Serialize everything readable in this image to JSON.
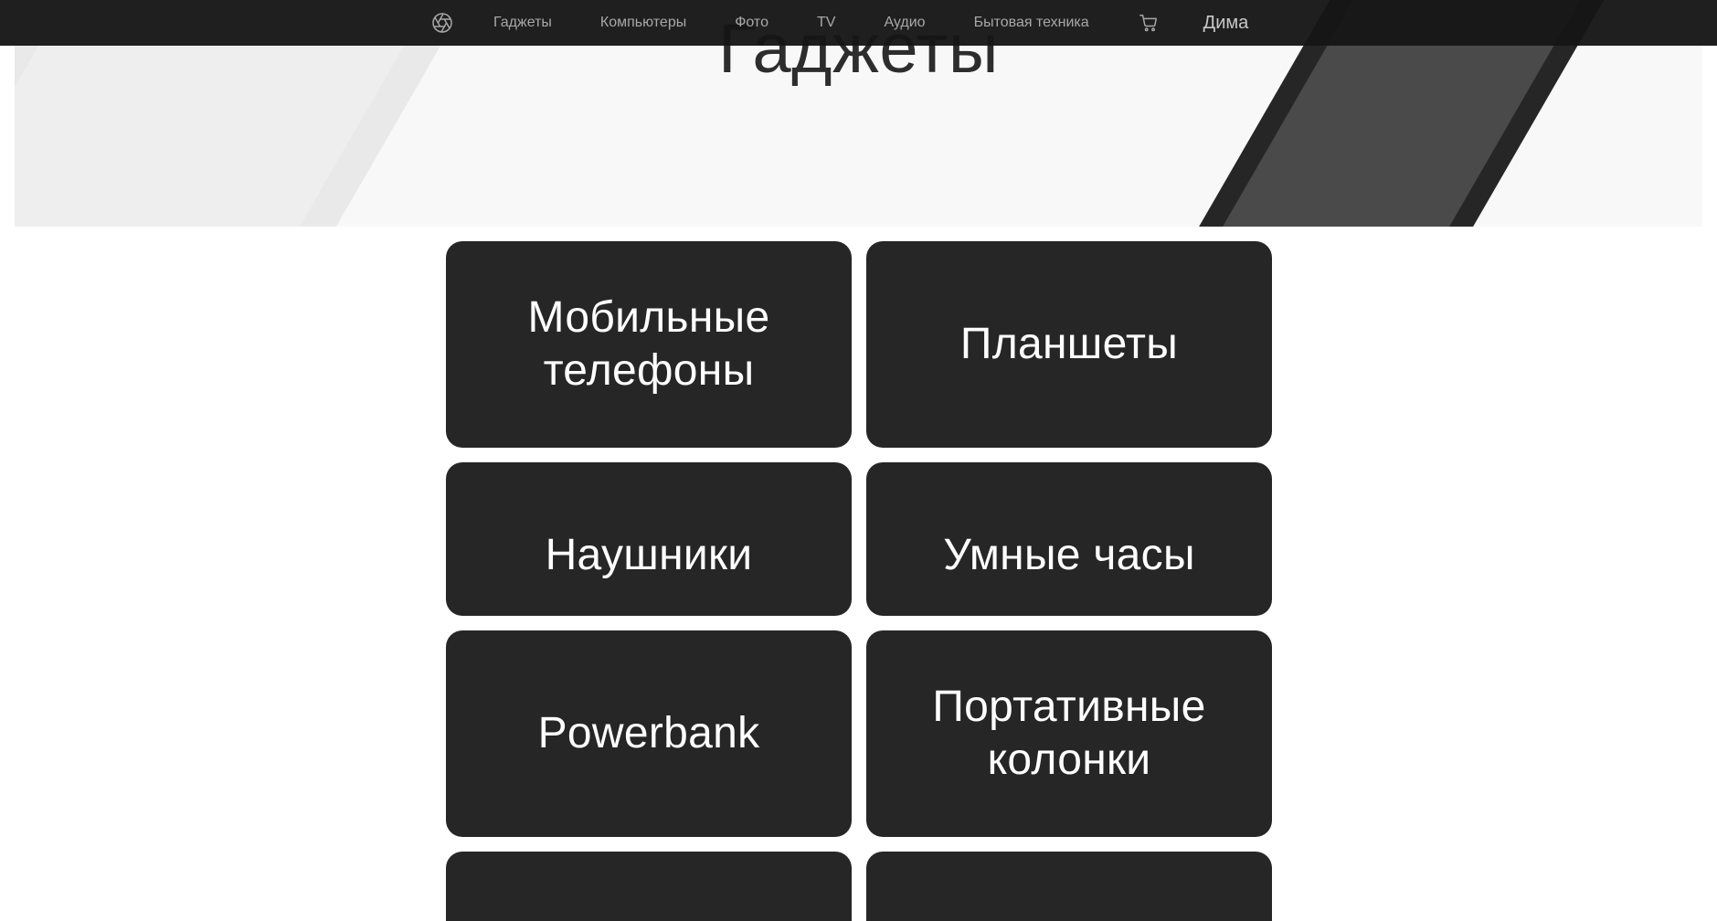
{
  "hero": {
    "title": "Гаджеты"
  },
  "navbar": {
    "logo_icon": "aperture-icon",
    "links": [
      {
        "label": "Гаджеты"
      },
      {
        "label": "Компьютеры"
      },
      {
        "label": "Фото"
      },
      {
        "label": "TV"
      },
      {
        "label": "Аудио"
      },
      {
        "label": "Бытовая техника"
      }
    ],
    "cart_icon": "cart-icon",
    "user_name": "Дима"
  },
  "categories": [
    {
      "label": "Мобильные телефоны"
    },
    {
      "label": "Планшеты"
    },
    {
      "label": "Наушники"
    },
    {
      "label": "Умные часы"
    },
    {
      "label": "Powerbank"
    },
    {
      "label": "Портативные колонки"
    },
    {
      "label": ""
    },
    {
      "label": ""
    }
  ],
  "colors": {
    "navbar_bg": "#161616",
    "card_bg": "#262626",
    "hero_bg": "#f8f8f8",
    "text_light": "#ffffff",
    "nav_text": "#a8a8a8"
  }
}
